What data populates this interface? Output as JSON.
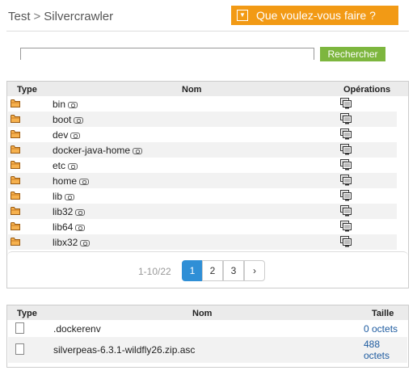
{
  "breadcrumb": {
    "root": "Test",
    "separator": ">",
    "current": "Silvercrawler"
  },
  "action_button": {
    "label": "Que voulez-vous faire ?",
    "icon": "dropdown-arrow-icon"
  },
  "search": {
    "value": "",
    "button_label": "Rechercher"
  },
  "folders_table": {
    "headers": {
      "type": "Type",
      "name": "Nom",
      "operations": "Opérations"
    },
    "rows": [
      {
        "name": "bin"
      },
      {
        "name": "boot"
      },
      {
        "name": "dev"
      },
      {
        "name": "docker-java-home"
      },
      {
        "name": "etc"
      },
      {
        "name": "home"
      },
      {
        "name": "lib"
      },
      {
        "name": "lib32"
      },
      {
        "name": "lib64"
      },
      {
        "name": "libx32"
      }
    ],
    "pagination": {
      "range": "1-10/22",
      "pages": [
        "1",
        "2",
        "3"
      ],
      "active": "1",
      "next": "›"
    }
  },
  "files_table": {
    "headers": {
      "type": "Type",
      "name": "Nom",
      "size": "Taille"
    },
    "rows": [
      {
        "name": ".dockerenv",
        "size_line1": "0 octets",
        "size_line2": ""
      },
      {
        "name": "silverpeas-6.3.1-wildfly26.zip.asc",
        "size_line1": "488",
        "size_line2": "octets"
      }
    ]
  },
  "colors": {
    "accent": "#f29a15",
    "search_button": "#7db63e",
    "active_page": "#2f8fd6",
    "link_text": "#1f5ca0"
  }
}
